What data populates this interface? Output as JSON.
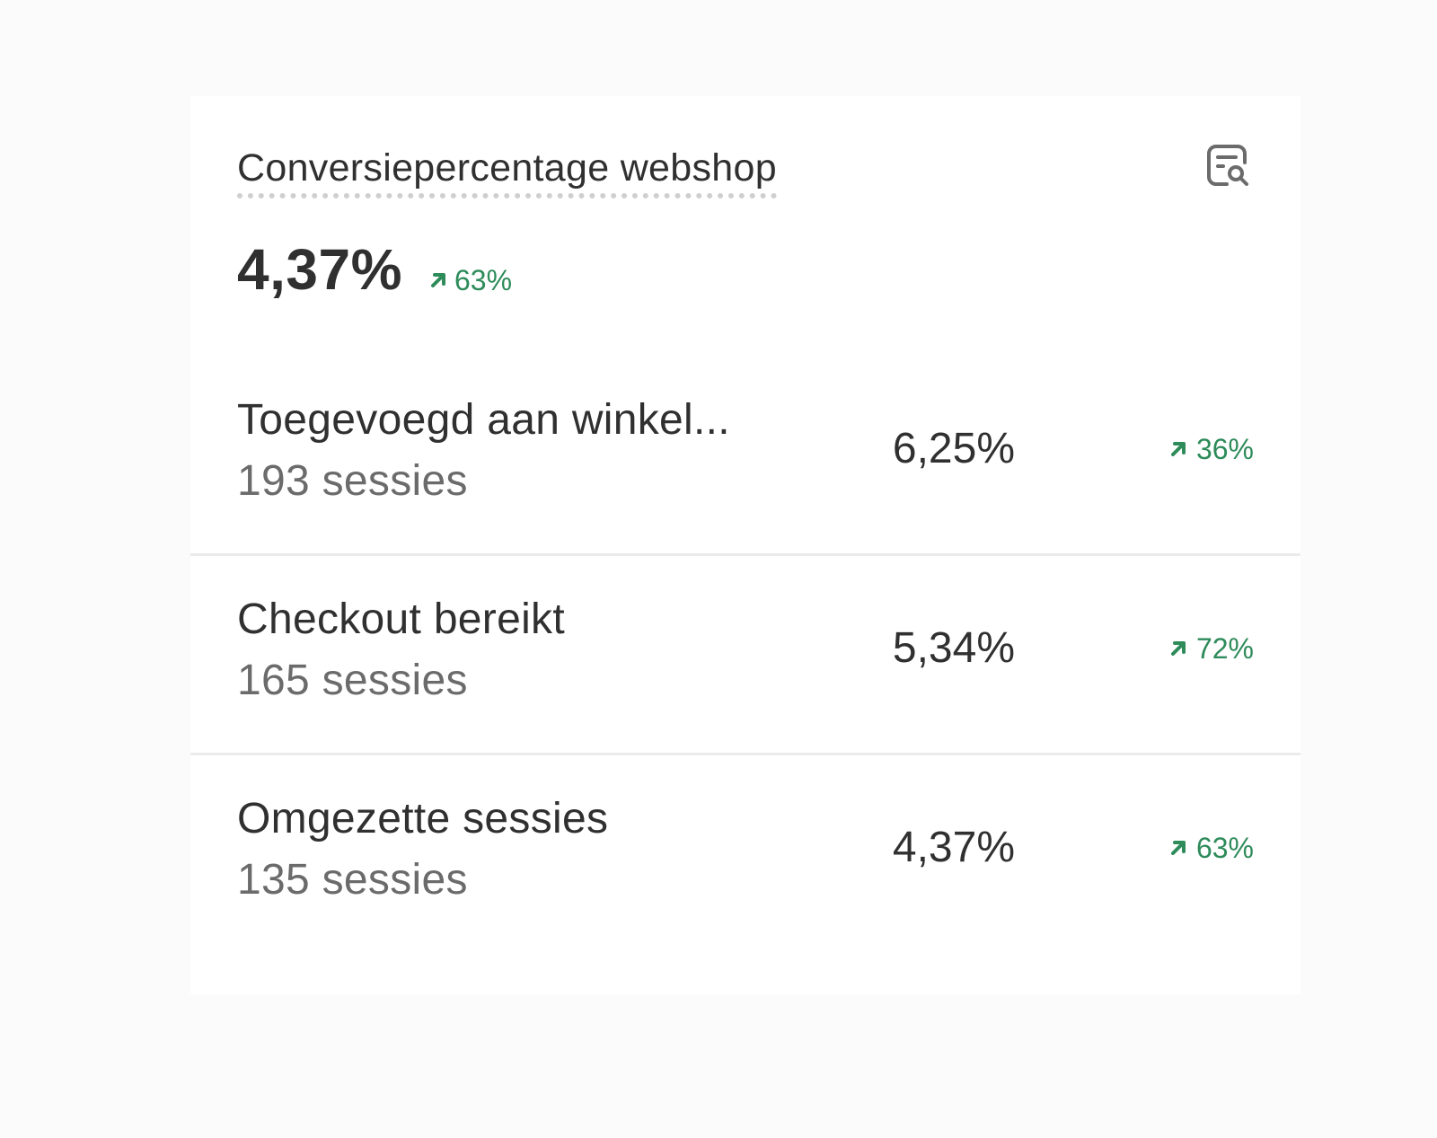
{
  "card": {
    "title": "Conversiepercentage webshop",
    "report_icon": "report-search-icon",
    "total": {
      "value": "4,37%",
      "change": "63%",
      "change_direction": "up"
    },
    "rows": [
      {
        "label": "Toegevoegd aan winkel...",
        "sessions": "193 sessies",
        "rate": "6,25%",
        "change": "36%",
        "change_direction": "up"
      },
      {
        "label": "Checkout bereikt",
        "sessions": "165 sessies",
        "rate": "5,34%",
        "change": "72%",
        "change_direction": "up"
      },
      {
        "label": "Omgezette sessies",
        "sessions": "135 sessies",
        "rate": "4,37%",
        "change": "63%",
        "change_direction": "up"
      }
    ]
  },
  "colors": {
    "positive": "#2e8b5a",
    "text": "#303030",
    "muted": "#6b6b6b",
    "divider": "#ebebeb"
  }
}
